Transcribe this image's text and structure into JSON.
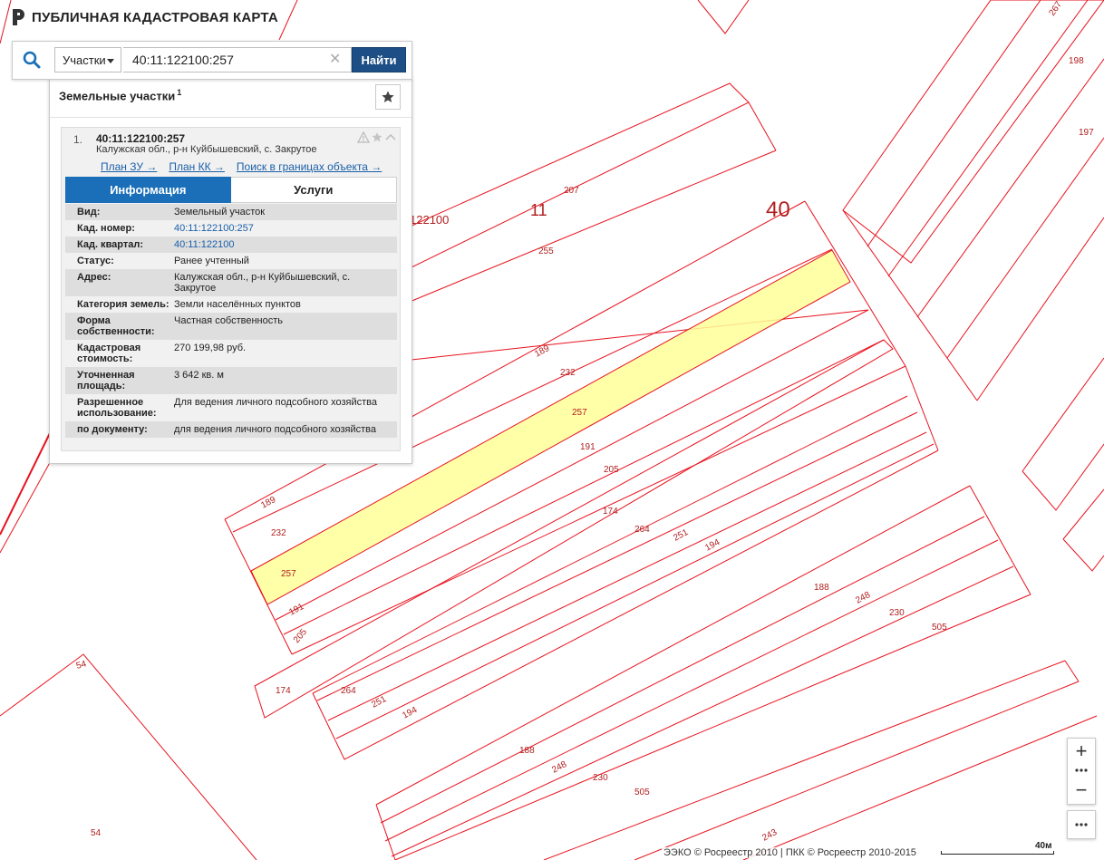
{
  "header": {
    "title": "ПУБЛИЧНАЯ КАДАСТРОВАЯ КАРТА"
  },
  "search": {
    "type_label": "Участки",
    "query": "40:11:122100:257",
    "find_label": "Найти"
  },
  "results": {
    "title": "Земельные участки",
    "count": "1",
    "item": {
      "number": "1.",
      "cad_number": "40:11:122100:257",
      "address": "Калужская обл., р-н Куйбышевский, с. Закрутое",
      "links": [
        "План ЗУ →",
        "План КК →",
        "Поиск в границах объекта →"
      ]
    },
    "tabs": [
      "Информация",
      "Услуги"
    ],
    "info": [
      {
        "label": "Вид:",
        "value": "Земельный участок",
        "link": false
      },
      {
        "label": "Кад. номер:",
        "value": "40:11:122100:257",
        "link": true
      },
      {
        "label": "Кад. квартал:",
        "value": "40:11:122100",
        "link": true
      },
      {
        "label": "Статус:",
        "value": "Ранее учтенный",
        "link": false
      },
      {
        "label": "Адрес:",
        "value": "Калужская обл., р-н Куйбышевский, с. Закрутое",
        "link": false
      },
      {
        "label": "Категория земель:",
        "value": "Земли населённых пунктов",
        "link": false
      },
      {
        "label": "Форма собственности:",
        "value": "Частная собственность",
        "link": false
      },
      {
        "label": "Кадастровая стоимость:",
        "value": "270 199,98 руб.",
        "link": false
      },
      {
        "label": "Уточненная площадь:",
        "value": "3 642 кв. м",
        "link": false
      },
      {
        "label": "Разрешенное использование:",
        "value": "Для ведения личного подсобного хозяйства",
        "link": false
      },
      {
        "label": "по документу:",
        "value": "для ведения личного подсобного хозяйства",
        "link": false
      }
    ]
  },
  "map": {
    "labels": {
      "district": "40",
      "region": "11",
      "quarter": "122100",
      "quarter_partial": "122100",
      "parcels": {
        "p267": "267",
        "p198": "198",
        "p197": "197",
        "p207": "207",
        "p255": "255",
        "p189a": "189",
        "p232a": "232",
        "p257a": "257",
        "p191a": "191",
        "p205a": "205",
        "p174a": "174",
        "p264a": "264",
        "p251a": "251",
        "p194a": "194",
        "p188a": "188",
        "p248a": "248",
        "p230a": "230",
        "p505a": "505",
        "p189b": "189",
        "p232b": "232",
        "p257b": "257",
        "p191b": "191",
        "p205b": "205",
        "p174b": "174",
        "p264b": "264",
        "p251b": "251",
        "p194b": "194",
        "p188b": "188",
        "p248b": "248",
        "p230b": "230",
        "p505b": "505",
        "p243": "243",
        "p54a": "54",
        "p54b": "54"
      }
    },
    "selected_parcel": "257",
    "colors": {
      "boundary": "#e8121e",
      "selected_fill": "#ffff99",
      "label": "#b01e1e"
    }
  },
  "controls": {
    "zoom_in": "+",
    "zoom_out": "−"
  },
  "footer": {
    "attribution": "ЭЭКО © Росреестр 2010 | ПКК © Росреестр 2010-2015",
    "scale": "40м"
  }
}
